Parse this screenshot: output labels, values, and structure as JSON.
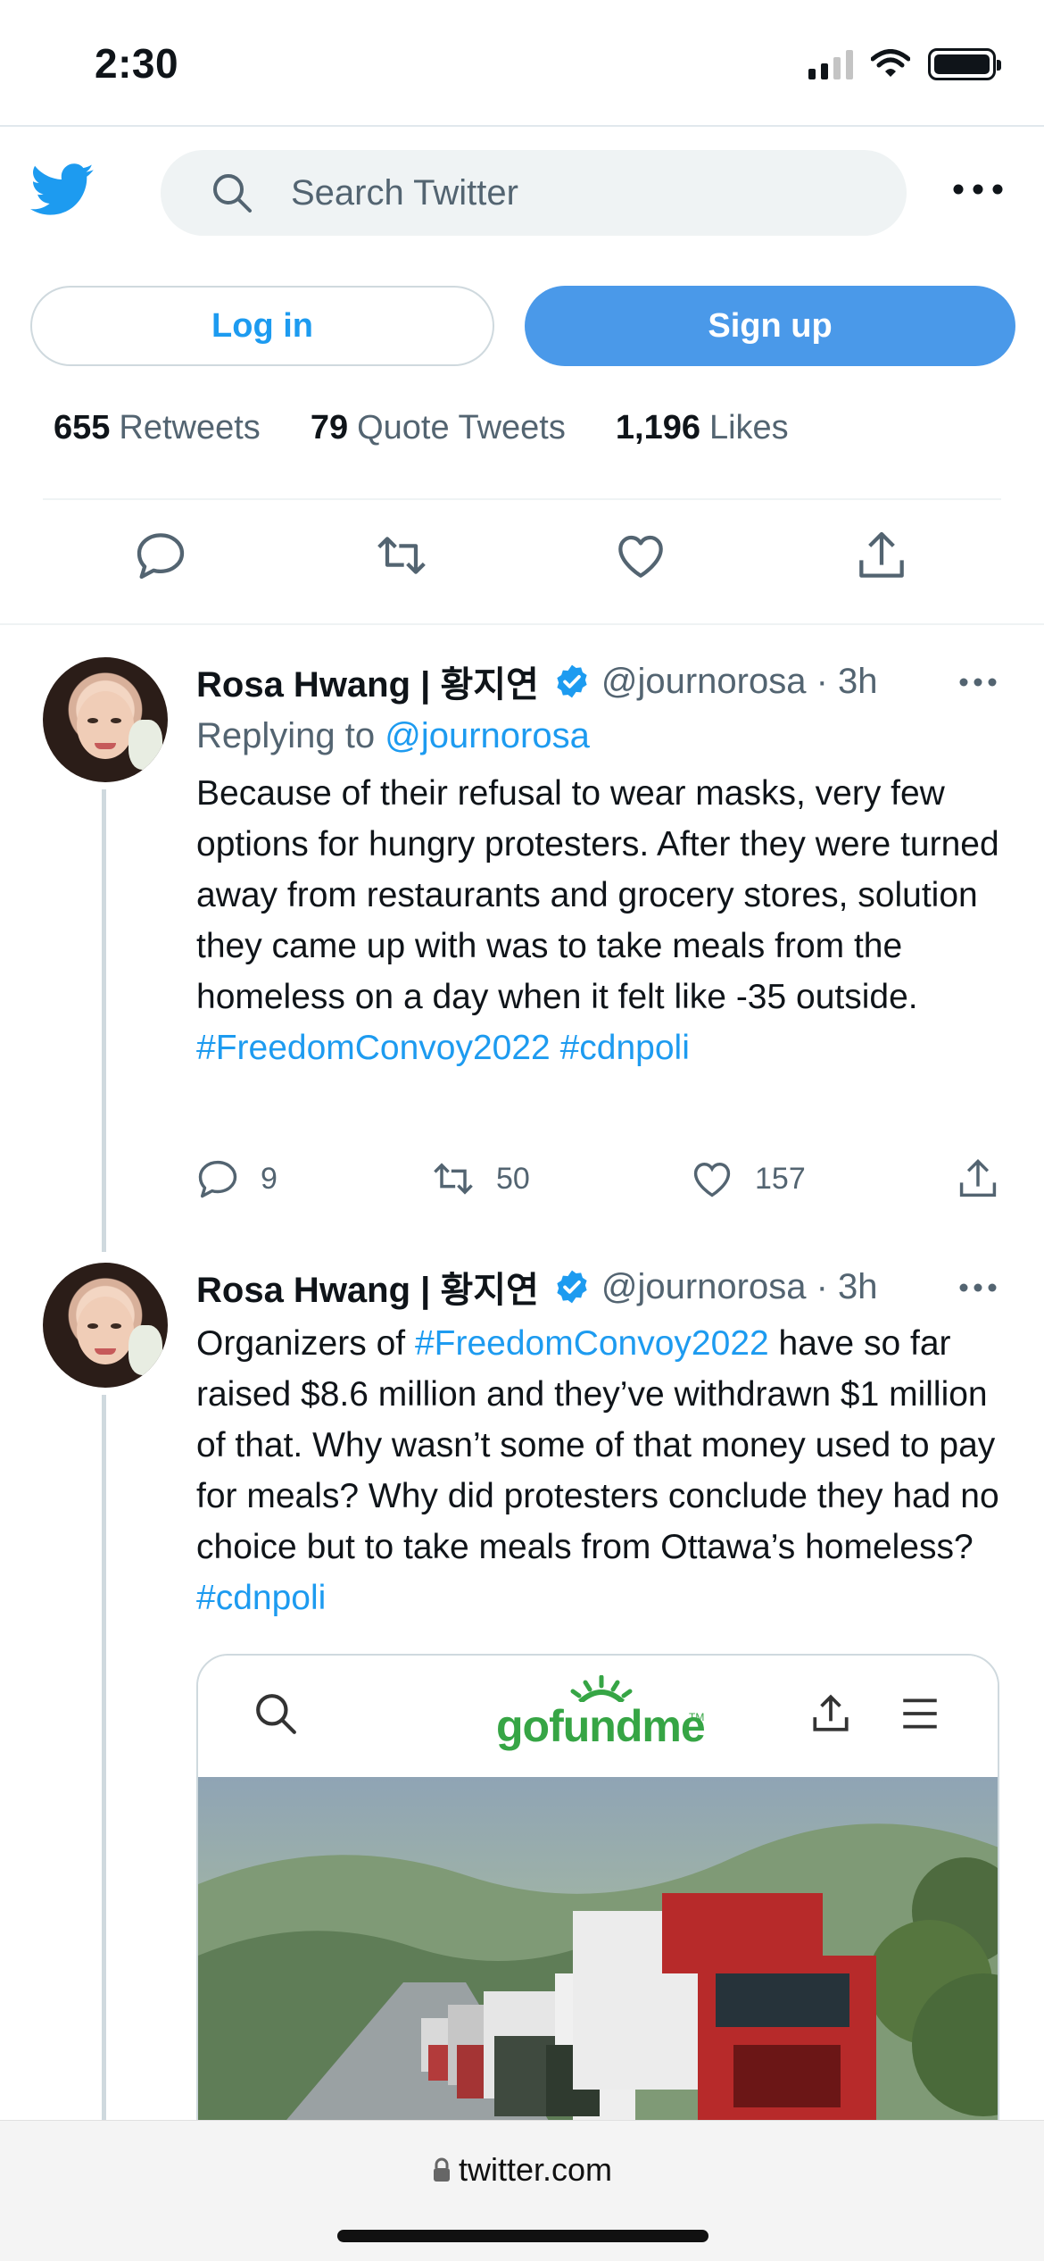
{
  "status_bar": {
    "time": "2:30"
  },
  "header": {
    "logo_icon": "twitter-bird-icon",
    "search_placeholder": "Search Twitter",
    "more_icon": "more-horizontal-icon"
  },
  "auth": {
    "login_label": "Log in",
    "signup_label": "Sign up"
  },
  "stats": {
    "retweets_count": "655",
    "retweets_label": "Retweets",
    "quotes_count": "79",
    "quotes_label": "Quote Tweets",
    "likes_count": "1,196",
    "likes_label": "Likes"
  },
  "tweets": [
    {
      "author": "Rosa Hwang | 황지연",
      "handle_time": "@journorosa · 3h",
      "replying_prefix": "Replying to",
      "replying_handle": "@journorosa",
      "text_main": "Because of their refusal to wear masks, very few options for hungry protesters. After they were turned away from restaurants and grocery stores, solution they came up with was to take meals from the homeless on a day when it felt like -35 outside.",
      "hashtag_1": "#FreedomConvoy2022",
      "hashtag_2": "#cdnpoli",
      "replies": "9",
      "retweets": "50",
      "likes": "157"
    },
    {
      "author": "Rosa Hwang | 황지연",
      "handle_time": "@journorosa · 3h",
      "text_before": "Organizers of",
      "hashtag_1": "#FreedomConvoy2022",
      "text_after": "have so far raised $8.6 million and they’ve withdrawn $1 million of that. Why wasn’t some of that money used to pay for meals? Why did protesters conclude they had no choice but to take meals from Ottawa’s homeless?",
      "hashtag_2": "#cdnpoli",
      "card_logo": "gofundme",
      "card_logo_tm": "TM"
    }
  ],
  "url_bar": {
    "url": "twitter.com"
  },
  "colors": {
    "accent": "#1d9bf0",
    "signup": "#4a99e9",
    "gofundme": "#36a545"
  }
}
